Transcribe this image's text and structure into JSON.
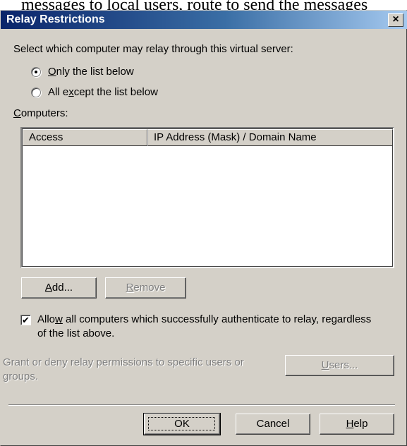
{
  "background_fragment": "messages to local users, route to send the messages",
  "dialog": {
    "title": "Relay Restrictions",
    "close_label": "×"
  },
  "selection": {
    "prompt": "Select which computer may relay through this virtual server:",
    "options": [
      {
        "hotkey": "O",
        "rest": "nly the list below",
        "selected": true
      },
      {
        "pre": "All e",
        "hotkey": "x",
        "rest": "cept the list below",
        "selected": false
      }
    ]
  },
  "computers": {
    "label_hotkey": "C",
    "label_rest": "omputers:",
    "columns": [
      "Access",
      "IP Address (Mask) / Domain Name"
    ],
    "rows": []
  },
  "list_buttons": {
    "add": {
      "hotkey": "A",
      "rest": "dd...",
      "enabled": true
    },
    "remove": {
      "hotkey": "R",
      "rest": "emove",
      "enabled": false
    }
  },
  "auth_option": {
    "checked": true,
    "line1_pre": "Allo",
    "line1_hotkey": "w",
    "line1_rest": " all computers which successfully authenticate to relay, regardless",
    "line2": "of the list above."
  },
  "permissions": {
    "line1": "Grant or deny relay permissions to specific users or",
    "line2": "groups.",
    "users_button": {
      "hotkey": "U",
      "rest": "sers...",
      "enabled": false
    }
  },
  "footer_buttons": {
    "ok": "OK",
    "cancel": "Cancel",
    "help": {
      "hotkey": "H",
      "rest": "elp"
    }
  }
}
